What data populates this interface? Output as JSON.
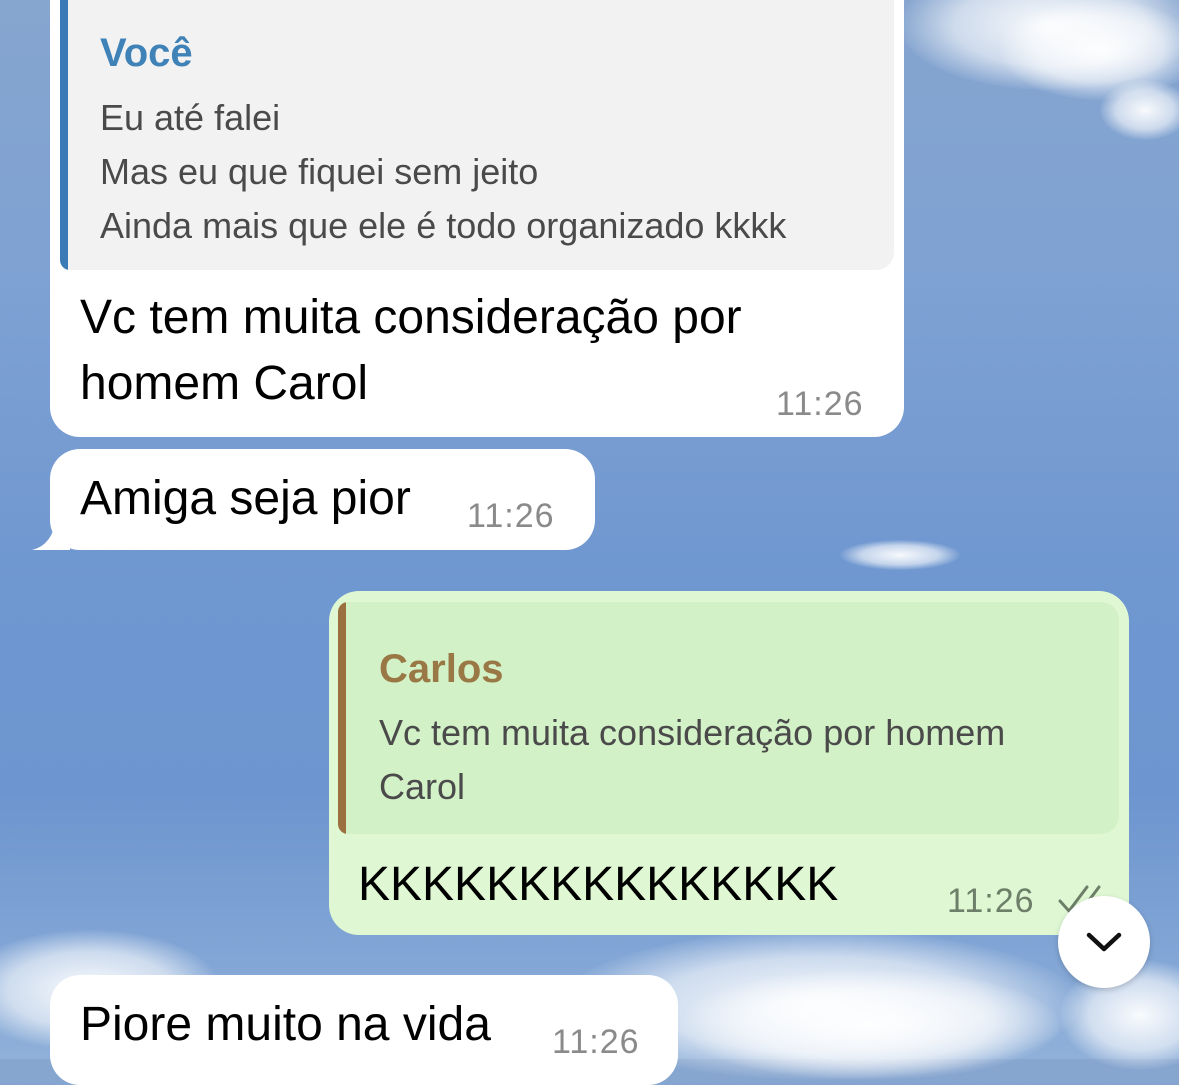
{
  "messages": [
    {
      "direction": "incoming",
      "reply": {
        "author": "Você",
        "lines": [
          "Eu até falei",
          "Mas eu que fiquei sem jeito",
          "Ainda mais que ele é todo organizado kkkk"
        ]
      },
      "text_lines": [
        "Vc tem muita consideração por",
        "homem Carol"
      ],
      "time": "11:26"
    },
    {
      "direction": "incoming",
      "text_lines": [
        "Amiga seja pior"
      ],
      "time": "11:26"
    },
    {
      "direction": "outgoing",
      "reply": {
        "author": "Carlos",
        "lines": [
          "Vc tem muita consideração por homem",
          "Carol"
        ]
      },
      "text_lines": [
        "KKKKKKKKKKKKKKK"
      ],
      "time": "11:26",
      "status": "read-double-check"
    },
    {
      "direction": "incoming",
      "text_lines": [
        "Piore muito na vida"
      ],
      "time": "11:26"
    }
  ],
  "scroll_button": {
    "icon": "chevron-down-icon"
  },
  "colors": {
    "incoming_bubble": "#ffffff",
    "outgoing_bubble": "#dff8d3",
    "quote_bar_incoming": "#3a7bb5",
    "quote_bar_outgoing": "#9a7040",
    "quote_author_incoming": "#3f82b8",
    "quote_author_outgoing": "#9a7845"
  }
}
